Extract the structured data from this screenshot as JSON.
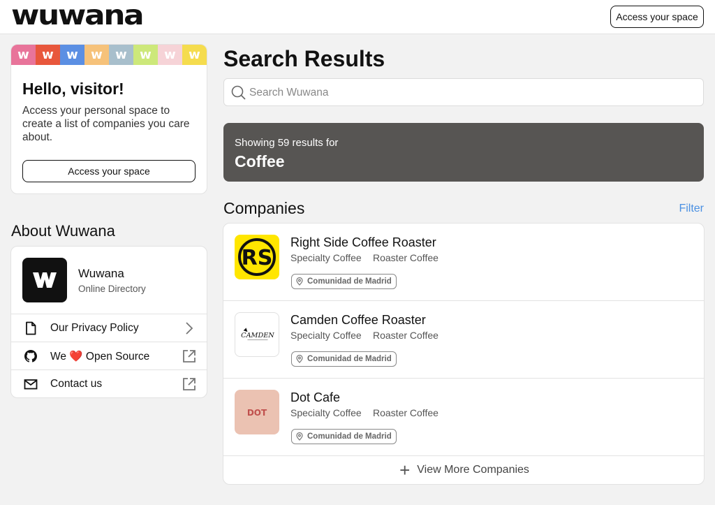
{
  "header": {
    "logo_text": "wuwana",
    "access_button": "Access your space"
  },
  "hello_card": {
    "tiles": [
      {
        "letter": "w",
        "color": "#e8749a"
      },
      {
        "letter": "w",
        "color": "#e8573c"
      },
      {
        "letter": "w",
        "color": "#5b8fe3"
      },
      {
        "letter": "w",
        "color": "#f6c27a"
      },
      {
        "letter": "w",
        "color": "#a8bfcc"
      },
      {
        "letter": "w",
        "color": "#cde87a"
      },
      {
        "letter": "w",
        "color": "#f6d3d7"
      },
      {
        "letter": "w",
        "color": "#f5dc4e"
      }
    ],
    "title": "Hello, visitor!",
    "text": "Access your personal space to create a list of companies you care about.",
    "button": "Access your space"
  },
  "about": {
    "title": "About Wuwana",
    "name": "Wuwana",
    "subtitle": "Online Directory",
    "links": [
      {
        "label": "Our Privacy Policy",
        "icon": "document-icon",
        "arrow": "chevron-right-icon"
      },
      {
        "label_prefix": "We",
        "label_heart": "❤️",
        "label_suffix": "Open Source",
        "icon": "github-icon",
        "arrow": "external-link-icon"
      },
      {
        "label": "Contact us",
        "icon": "mail-icon",
        "arrow": "external-link-icon"
      }
    ]
  },
  "search": {
    "title": "Search Results",
    "placeholder": "Search Wuwana",
    "banner_line": "Showing 59 results for",
    "query": "Coffee"
  },
  "companies": {
    "title": "Companies",
    "filter": "Filter",
    "items": [
      {
        "name": "Right Side Coffee Roaster",
        "tags": [
          "Specialty Coffee",
          "Roaster Coffee"
        ],
        "location": "Comunidad de Madrid",
        "logo_text": "RS",
        "logo_bg": "#ffe600"
      },
      {
        "name": "Camden Coffee Roaster",
        "tags": [
          "Specialty Coffee",
          "Roaster Coffee"
        ],
        "location": "Comunidad de Madrid",
        "logo_text": "CAMDEN",
        "logo_bg": "#ffffff"
      },
      {
        "name": "Dot Cafe",
        "tags": [
          "Specialty Coffee",
          "Roaster Coffee"
        ],
        "location": "Comunidad de Madrid",
        "logo_text": "DOT",
        "logo_bg": "#ebc2b2"
      }
    ],
    "view_more": "View More Companies"
  }
}
